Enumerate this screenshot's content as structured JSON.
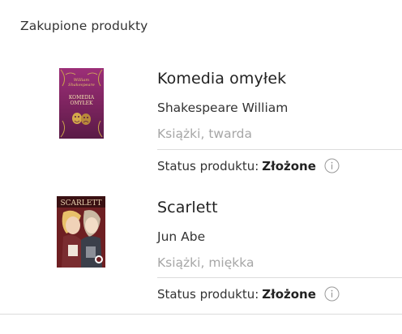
{
  "section": {
    "title": "Zakupione produkty"
  },
  "products": [
    {
      "title": "Komedia omyłek",
      "author": "Shakespeare William",
      "format": "Książki, twarda",
      "status_label": "Status produktu:",
      "status_value": "Złożone",
      "cover": {
        "author_text": "William Shakespeare",
        "title_text": "KOMEDIA OMYŁEK",
        "bg": "#8e2a6a",
        "accent": "#c9a24a"
      }
    },
    {
      "title": "Scarlett",
      "author": "Jun Abe",
      "format": "Książki, miękka",
      "status_label": "Status produktu:",
      "status_value": "Złożone",
      "cover": {
        "title_text": "SCARLETT",
        "bg": "#6e1f22",
        "accent": "#e8d2b0"
      }
    }
  ],
  "icons": {
    "info": "info-icon"
  }
}
